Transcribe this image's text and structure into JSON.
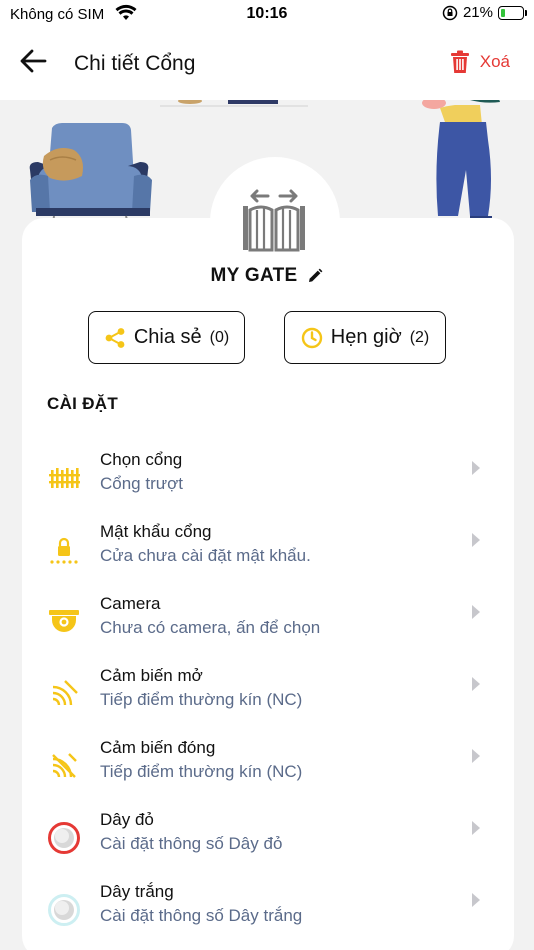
{
  "status_bar": {
    "carrier": "Không có SIM",
    "time": "10:16",
    "battery_percent": "21%",
    "battery_level": 0.21
  },
  "header": {
    "title": "Chi tiết Cổng",
    "delete_label": "Xoá"
  },
  "gate": {
    "name": "MY GATE"
  },
  "actions": {
    "share_label": "Chia sẻ",
    "share_count": "(0)",
    "timer_label": "Hẹn giờ",
    "timer_count": "(2)"
  },
  "settings": {
    "section_title": "CÀI ĐẶT",
    "items": [
      {
        "title": "Chọn cổng",
        "subtitle": "Cổng trượt",
        "icon": "fence-icon"
      },
      {
        "title": "Mật khẩu cổng",
        "subtitle": "Cửa chưa cài đặt mật khẩu.",
        "icon": "password-lock-icon"
      },
      {
        "title": "Camera",
        "subtitle": "Chưa có camera, ấn để chọn",
        "icon": "camera-icon"
      },
      {
        "title": "Cảm biến mở",
        "subtitle": "Tiếp điểm thường kín (NC)",
        "icon": "sensor-open-icon"
      },
      {
        "title": "Cảm biến đóng",
        "subtitle": "Tiếp điểm thường kín (NC)",
        "icon": "sensor-close-icon"
      },
      {
        "title": "Dây đỏ",
        "subtitle": "Cài đặt thông số Dây đỏ",
        "icon": "red-wire-icon"
      },
      {
        "title": "Dây trắng",
        "subtitle": "Cài đặt thông số Dây trắng",
        "icon": "white-wire-icon"
      }
    ]
  },
  "colors": {
    "accent_yellow": "#f5c518",
    "delete_red": "#e53935",
    "subtitle_blue": "#5b6b8a"
  }
}
